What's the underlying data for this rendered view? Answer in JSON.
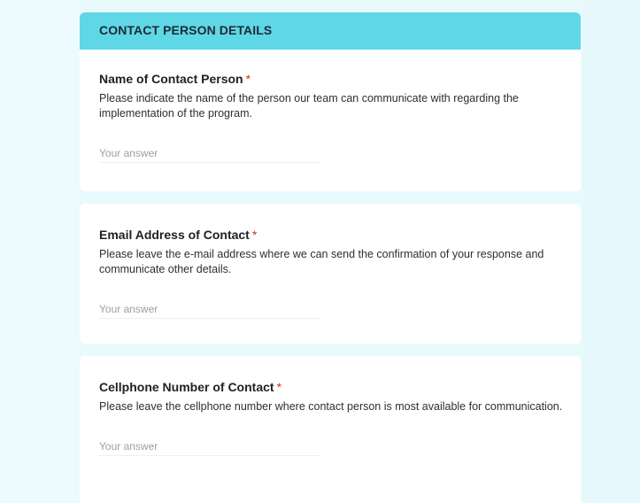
{
  "section": {
    "title": "CONTACT PERSON DETAILS"
  },
  "questions": [
    {
      "title": "Name of Contact Person",
      "required_mark": "*",
      "description": "Please indicate the name of the person our team can communicate with regarding the implementation of the program.",
      "placeholder": "Your answer"
    },
    {
      "title": "Email Address of Contact",
      "required_mark": "*",
      "description": "Please leave the e-mail address where we can send the confirmation of your response and communicate other details.",
      "placeholder": "Your answer"
    },
    {
      "title": "Cellphone Number of Contact",
      "required_mark": "*",
      "description": "Please leave the cellphone number where contact person is most available for communication.",
      "placeholder": "Your answer"
    }
  ],
  "colors": {
    "header": "#5fd7e6",
    "background": "#e9fafd",
    "required": "#d93025"
  }
}
